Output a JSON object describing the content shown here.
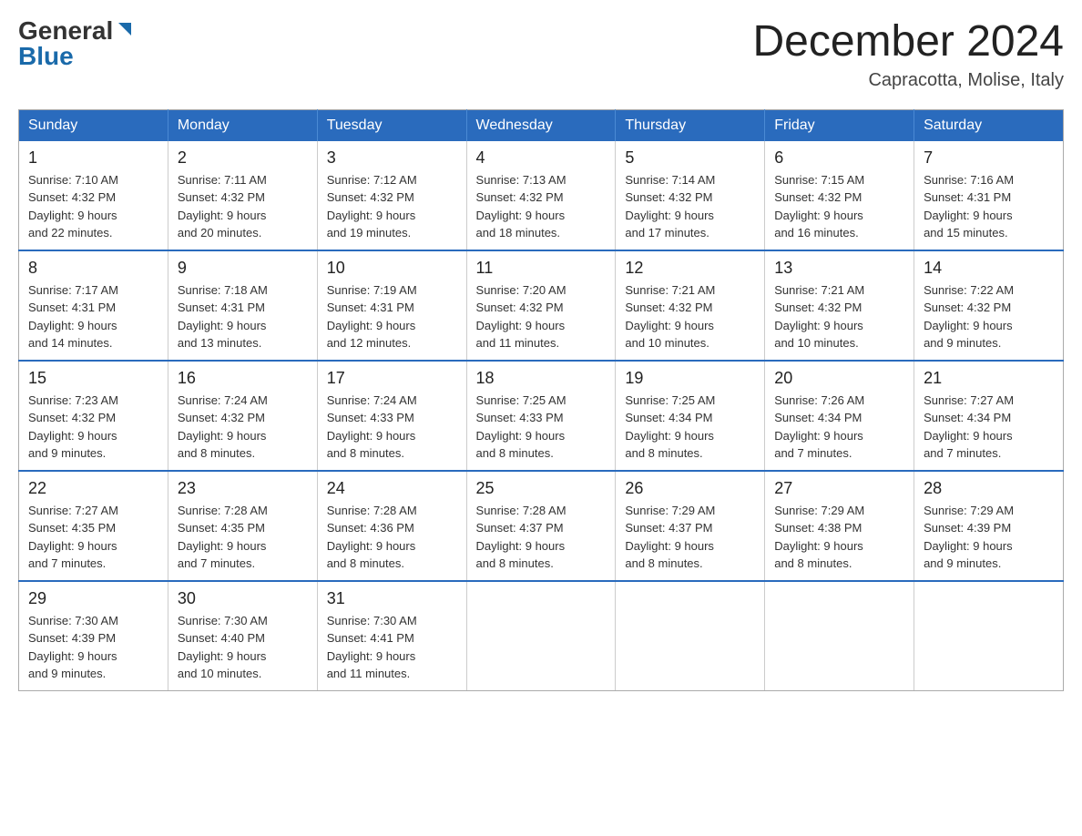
{
  "header": {
    "logo_general": "General",
    "logo_blue": "Blue",
    "month_title": "December 2024",
    "location": "Capracotta, Molise, Italy"
  },
  "days_of_week": [
    "Sunday",
    "Monday",
    "Tuesday",
    "Wednesday",
    "Thursday",
    "Friday",
    "Saturday"
  ],
  "weeks": [
    [
      {
        "day": "1",
        "sunrise": "7:10 AM",
        "sunset": "4:32 PM",
        "daylight": "9 hours and 22 minutes."
      },
      {
        "day": "2",
        "sunrise": "7:11 AM",
        "sunset": "4:32 PM",
        "daylight": "9 hours and 20 minutes."
      },
      {
        "day": "3",
        "sunrise": "7:12 AM",
        "sunset": "4:32 PM",
        "daylight": "9 hours and 19 minutes."
      },
      {
        "day": "4",
        "sunrise": "7:13 AM",
        "sunset": "4:32 PM",
        "daylight": "9 hours and 18 minutes."
      },
      {
        "day": "5",
        "sunrise": "7:14 AM",
        "sunset": "4:32 PM",
        "daylight": "9 hours and 17 minutes."
      },
      {
        "day": "6",
        "sunrise": "7:15 AM",
        "sunset": "4:32 PM",
        "daylight": "9 hours and 16 minutes."
      },
      {
        "day": "7",
        "sunrise": "7:16 AM",
        "sunset": "4:31 PM",
        "daylight": "9 hours and 15 minutes."
      }
    ],
    [
      {
        "day": "8",
        "sunrise": "7:17 AM",
        "sunset": "4:31 PM",
        "daylight": "9 hours and 14 minutes."
      },
      {
        "day": "9",
        "sunrise": "7:18 AM",
        "sunset": "4:31 PM",
        "daylight": "9 hours and 13 minutes."
      },
      {
        "day": "10",
        "sunrise": "7:19 AM",
        "sunset": "4:31 PM",
        "daylight": "9 hours and 12 minutes."
      },
      {
        "day": "11",
        "sunrise": "7:20 AM",
        "sunset": "4:32 PM",
        "daylight": "9 hours and 11 minutes."
      },
      {
        "day": "12",
        "sunrise": "7:21 AM",
        "sunset": "4:32 PM",
        "daylight": "9 hours and 10 minutes."
      },
      {
        "day": "13",
        "sunrise": "7:21 AM",
        "sunset": "4:32 PM",
        "daylight": "9 hours and 10 minutes."
      },
      {
        "day": "14",
        "sunrise": "7:22 AM",
        "sunset": "4:32 PM",
        "daylight": "9 hours and 9 minutes."
      }
    ],
    [
      {
        "day": "15",
        "sunrise": "7:23 AM",
        "sunset": "4:32 PM",
        "daylight": "9 hours and 9 minutes."
      },
      {
        "day": "16",
        "sunrise": "7:24 AM",
        "sunset": "4:32 PM",
        "daylight": "9 hours and 8 minutes."
      },
      {
        "day": "17",
        "sunrise": "7:24 AM",
        "sunset": "4:33 PM",
        "daylight": "9 hours and 8 minutes."
      },
      {
        "day": "18",
        "sunrise": "7:25 AM",
        "sunset": "4:33 PM",
        "daylight": "9 hours and 8 minutes."
      },
      {
        "day": "19",
        "sunrise": "7:25 AM",
        "sunset": "4:34 PM",
        "daylight": "9 hours and 8 minutes."
      },
      {
        "day": "20",
        "sunrise": "7:26 AM",
        "sunset": "4:34 PM",
        "daylight": "9 hours and 7 minutes."
      },
      {
        "day": "21",
        "sunrise": "7:27 AM",
        "sunset": "4:34 PM",
        "daylight": "9 hours and 7 minutes."
      }
    ],
    [
      {
        "day": "22",
        "sunrise": "7:27 AM",
        "sunset": "4:35 PM",
        "daylight": "9 hours and 7 minutes."
      },
      {
        "day": "23",
        "sunrise": "7:28 AM",
        "sunset": "4:35 PM",
        "daylight": "9 hours and 7 minutes."
      },
      {
        "day": "24",
        "sunrise": "7:28 AM",
        "sunset": "4:36 PM",
        "daylight": "9 hours and 8 minutes."
      },
      {
        "day": "25",
        "sunrise": "7:28 AM",
        "sunset": "4:37 PM",
        "daylight": "9 hours and 8 minutes."
      },
      {
        "day": "26",
        "sunrise": "7:29 AM",
        "sunset": "4:37 PM",
        "daylight": "9 hours and 8 minutes."
      },
      {
        "day": "27",
        "sunrise": "7:29 AM",
        "sunset": "4:38 PM",
        "daylight": "9 hours and 8 minutes."
      },
      {
        "day": "28",
        "sunrise": "7:29 AM",
        "sunset": "4:39 PM",
        "daylight": "9 hours and 9 minutes."
      }
    ],
    [
      {
        "day": "29",
        "sunrise": "7:30 AM",
        "sunset": "4:39 PM",
        "daylight": "9 hours and 9 minutes."
      },
      {
        "day": "30",
        "sunrise": "7:30 AM",
        "sunset": "4:40 PM",
        "daylight": "9 hours and 10 minutes."
      },
      {
        "day": "31",
        "sunrise": "7:30 AM",
        "sunset": "4:41 PM",
        "daylight": "9 hours and 11 minutes."
      },
      null,
      null,
      null,
      null
    ]
  ],
  "labels": {
    "sunrise": "Sunrise:",
    "sunset": "Sunset:",
    "daylight": "Daylight:"
  }
}
